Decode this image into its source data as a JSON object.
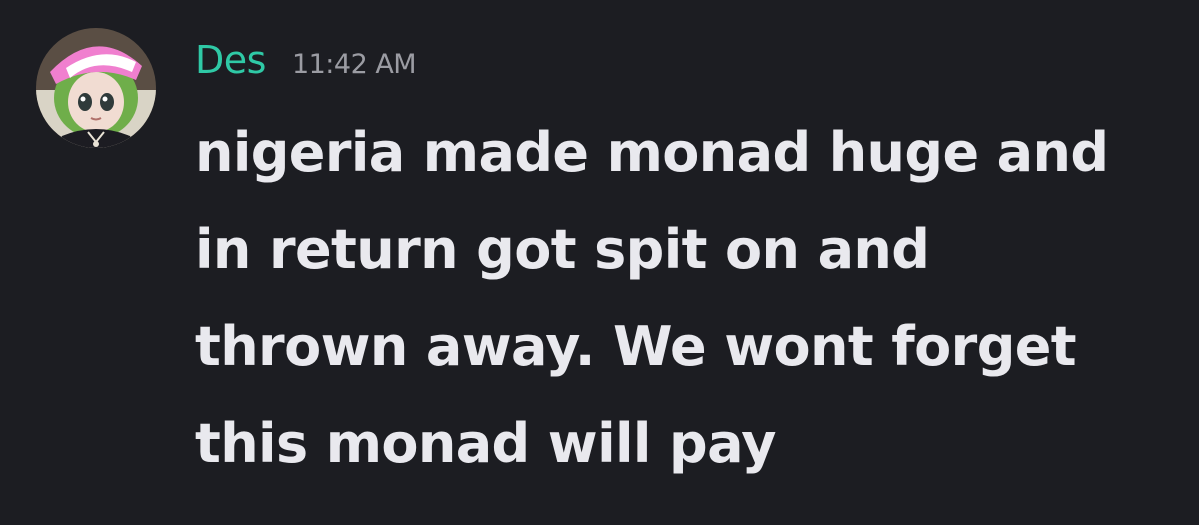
{
  "message": {
    "author": "Des",
    "timestamp": "11:42 AM",
    "lines": [
      "nigeria made monad huge and",
      "in return got spit on and",
      "thrown away. We wont forget",
      "this monad will pay"
    ]
  },
  "colors": {
    "background": "#1c1d22",
    "author_name": "#2fc9a6",
    "timestamp": "#9b9ca3",
    "message_text": "#e9e9ee"
  },
  "avatar": {
    "icon": "anime-girl-avatar-icon"
  }
}
